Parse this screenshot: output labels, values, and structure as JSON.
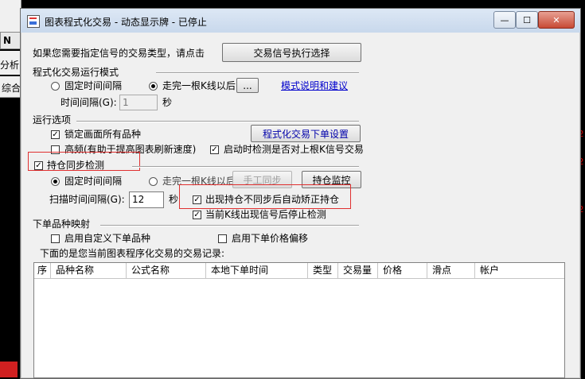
{
  "window": {
    "title": "图表程式化交易 - 动态显示牌 - 已停止",
    "minimize_symbol": "—",
    "maximize_symbol": "☐",
    "close_symbol": "✕"
  },
  "background": {
    "toolbar_glyph": "N",
    "menu_text": "分析(",
    "tab_text": "综合"
  },
  "signal_select": {
    "prompt": "如果您需要指定信号的交易类型，请点击",
    "button": "交易信号执行选择"
  },
  "run_mode": {
    "group_title": "程式化交易运行模式",
    "radio_fixed": "固定时间间隔",
    "radio_after_bar": "走完一根K线以后",
    "ellipsis_button": "...",
    "help_link": "模式说明和建议",
    "interval_label": "时间间隔(G):",
    "interval_value": "1",
    "interval_unit": "秒"
  },
  "run_options": {
    "group_title": "运行选项",
    "lock_label": "锁定画面所有品种",
    "lock_checked": true,
    "order_settings_button": "程式化交易下单设置",
    "highfreq_label": "高频(有助于提高图表刷新速度)",
    "highfreq_checked": false,
    "startup_check_label": "启动时检测是否对上根K信号交易",
    "startup_check_checked": true
  },
  "position_sync": {
    "title_label": "持仓同步检测",
    "enabled": true,
    "radio_fixed": "固定时间间隔",
    "radio_after_bar": "走完一根K线以后",
    "manual_sync_button": "手工同步",
    "monitor_button": "持仓监控",
    "scan_label": "扫描时间间隔(G):",
    "scan_value": "12",
    "scan_unit": "秒",
    "auto_fix_label": "出现持仓不同步后自动矫正持仓",
    "auto_fix_checked": true,
    "stop_on_signal_label": "当前K线出现信号后停止检测",
    "stop_on_signal_checked": true
  },
  "order_mapping": {
    "group_title": "下单品种映射",
    "custom_symbol_label": "启用自定义下单品种",
    "custom_symbol_checked": false,
    "price_offset_label": "启用下单价格偏移",
    "price_offset_checked": false
  },
  "records": {
    "caption": "下面的是您当前图表程序化交易的交易记录:",
    "columns": [
      "序",
      "品种名称",
      "公式名称",
      "本地下单时间",
      "类型",
      "交易量",
      "价格",
      "滑点",
      "帐户"
    ]
  },
  "colors": {
    "highlight_box": "#e03030",
    "link": "#0000cc"
  }
}
